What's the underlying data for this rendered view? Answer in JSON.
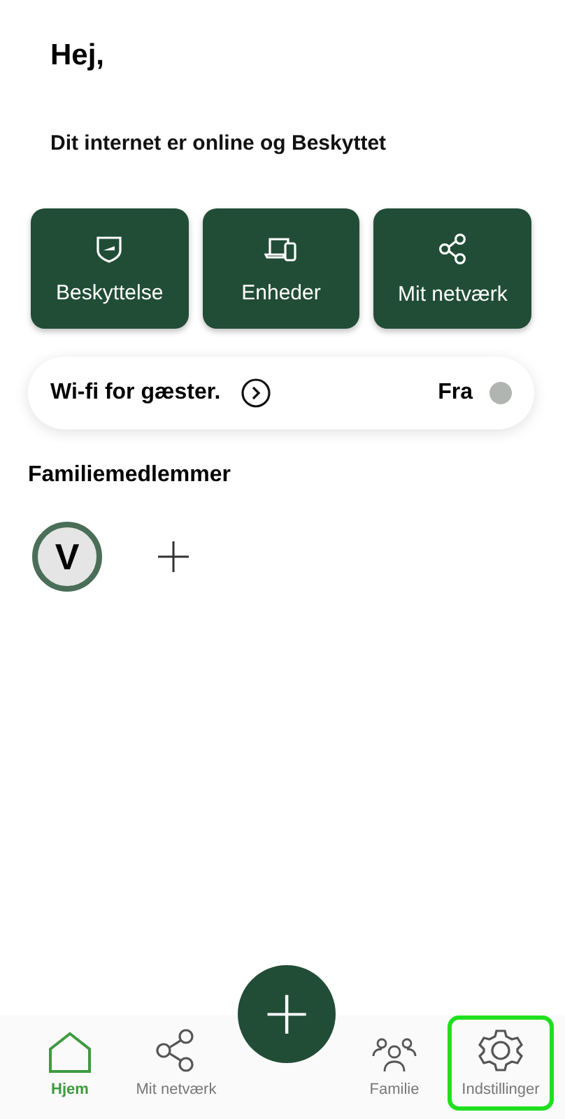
{
  "greeting": "Hej,",
  "status": "Dit internet er online og Beskyttet",
  "tiles": [
    {
      "kind": "shield",
      "label": "Beskyttelse"
    },
    {
      "kind": "devices",
      "label": "Enheder"
    },
    {
      "kind": "share",
      "label": "Mit netværk"
    }
  ],
  "guest_wifi": {
    "label": "Wi-fi for gæster.",
    "state_text": "Fra",
    "on": false
  },
  "family": {
    "title": "Familiemedlemmer",
    "members": [
      {
        "initial": "V"
      }
    ]
  },
  "fab": {
    "label": "+"
  },
  "nav": [
    {
      "kind": "home",
      "label": "Hjem",
      "selected": true,
      "highlighted": false
    },
    {
      "kind": "share",
      "label": "Mit netværk",
      "selected": false,
      "highlighted": false
    },
    {
      "kind": "family",
      "label": "Familie",
      "selected": false,
      "highlighted": false
    },
    {
      "kind": "gear",
      "label": "Indstillinger",
      "selected": false,
      "highlighted": true
    }
  ]
}
